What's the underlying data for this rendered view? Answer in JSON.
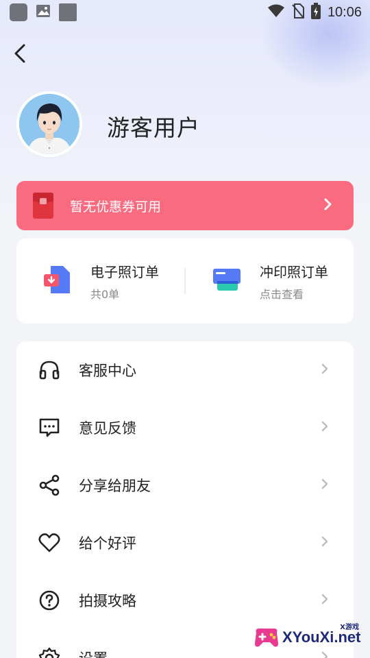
{
  "status_bar": {
    "time": "10:06"
  },
  "profile": {
    "username": "游客用户"
  },
  "coupon": {
    "text": "暂无优惠券可用",
    "color": "#fb6b80"
  },
  "orders": [
    {
      "title": "电子照订单",
      "subtitle": "共0单",
      "icon": "e-photo-order-icon"
    },
    {
      "title": "冲印照订单",
      "subtitle": "点击查看",
      "icon": "print-order-icon"
    }
  ],
  "menu": [
    {
      "label": "客服中心",
      "icon": "headset-icon"
    },
    {
      "label": "意见反馈",
      "icon": "feedback-icon"
    },
    {
      "label": "分享给朋友",
      "icon": "share-icon"
    },
    {
      "label": "给个好评",
      "icon": "heart-icon"
    },
    {
      "label": "拍摄攻略",
      "icon": "help-icon"
    },
    {
      "label": "设置",
      "icon": "settings-icon"
    }
  ],
  "watermark": {
    "text": "XYouXi.net",
    "small": "X游戏"
  }
}
